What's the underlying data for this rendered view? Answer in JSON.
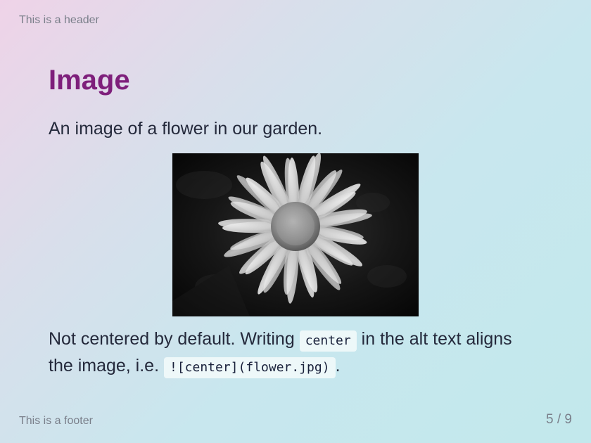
{
  "slide": {
    "header": "This is a header",
    "title": "Image",
    "intro": "An image of a flower in our garden.",
    "image_alt": "flower",
    "body_part_1": "Not centered by default. Writing",
    "code_center": "center",
    "body_part_2": "in the alt text aligns the image, i.e.",
    "code_markdown": "![center](flower.jpg)",
    "body_end": ".",
    "footer": "This is a footer",
    "page_number": "5 / 9"
  },
  "colors": {
    "title": "#7e1f7b",
    "text": "#24293b",
    "muted": "#7a7f8a",
    "background_start": "#efd3e8",
    "background_end": "#c2e8ec"
  }
}
